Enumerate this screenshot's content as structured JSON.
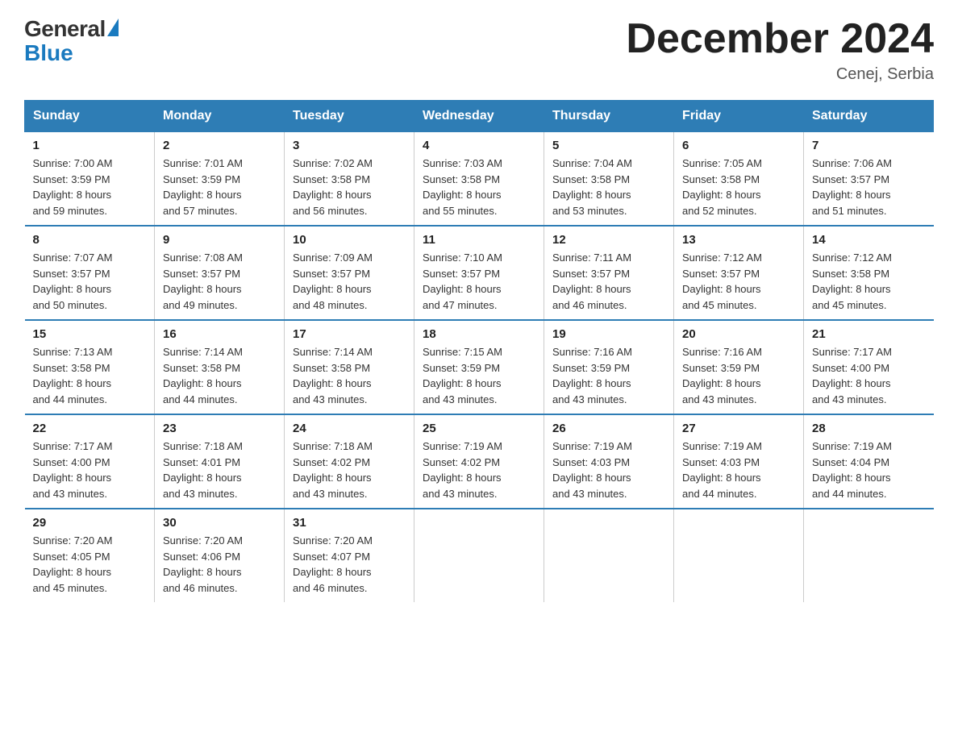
{
  "logo": {
    "general": "General",
    "blue": "Blue"
  },
  "header": {
    "title": "December 2024",
    "location": "Cenej, Serbia"
  },
  "days_of_week": [
    "Sunday",
    "Monday",
    "Tuesday",
    "Wednesday",
    "Thursday",
    "Friday",
    "Saturday"
  ],
  "weeks": [
    [
      {
        "num": "1",
        "sunrise": "7:00 AM",
        "sunset": "3:59 PM",
        "daylight": "8 hours and 59 minutes."
      },
      {
        "num": "2",
        "sunrise": "7:01 AM",
        "sunset": "3:59 PM",
        "daylight": "8 hours and 57 minutes."
      },
      {
        "num": "3",
        "sunrise": "7:02 AM",
        "sunset": "3:58 PM",
        "daylight": "8 hours and 56 minutes."
      },
      {
        "num": "4",
        "sunrise": "7:03 AM",
        "sunset": "3:58 PM",
        "daylight": "8 hours and 55 minutes."
      },
      {
        "num": "5",
        "sunrise": "7:04 AM",
        "sunset": "3:58 PM",
        "daylight": "8 hours and 53 minutes."
      },
      {
        "num": "6",
        "sunrise": "7:05 AM",
        "sunset": "3:58 PM",
        "daylight": "8 hours and 52 minutes."
      },
      {
        "num": "7",
        "sunrise": "7:06 AM",
        "sunset": "3:57 PM",
        "daylight": "8 hours and 51 minutes."
      }
    ],
    [
      {
        "num": "8",
        "sunrise": "7:07 AM",
        "sunset": "3:57 PM",
        "daylight": "8 hours and 50 minutes."
      },
      {
        "num": "9",
        "sunrise": "7:08 AM",
        "sunset": "3:57 PM",
        "daylight": "8 hours and 49 minutes."
      },
      {
        "num": "10",
        "sunrise": "7:09 AM",
        "sunset": "3:57 PM",
        "daylight": "8 hours and 48 minutes."
      },
      {
        "num": "11",
        "sunrise": "7:10 AM",
        "sunset": "3:57 PM",
        "daylight": "8 hours and 47 minutes."
      },
      {
        "num": "12",
        "sunrise": "7:11 AM",
        "sunset": "3:57 PM",
        "daylight": "8 hours and 46 minutes."
      },
      {
        "num": "13",
        "sunrise": "7:12 AM",
        "sunset": "3:57 PM",
        "daylight": "8 hours and 45 minutes."
      },
      {
        "num": "14",
        "sunrise": "7:12 AM",
        "sunset": "3:58 PM",
        "daylight": "8 hours and 45 minutes."
      }
    ],
    [
      {
        "num": "15",
        "sunrise": "7:13 AM",
        "sunset": "3:58 PM",
        "daylight": "8 hours and 44 minutes."
      },
      {
        "num": "16",
        "sunrise": "7:14 AM",
        "sunset": "3:58 PM",
        "daylight": "8 hours and 44 minutes."
      },
      {
        "num": "17",
        "sunrise": "7:14 AM",
        "sunset": "3:58 PM",
        "daylight": "8 hours and 43 minutes."
      },
      {
        "num": "18",
        "sunrise": "7:15 AM",
        "sunset": "3:59 PM",
        "daylight": "8 hours and 43 minutes."
      },
      {
        "num": "19",
        "sunrise": "7:16 AM",
        "sunset": "3:59 PM",
        "daylight": "8 hours and 43 minutes."
      },
      {
        "num": "20",
        "sunrise": "7:16 AM",
        "sunset": "3:59 PM",
        "daylight": "8 hours and 43 minutes."
      },
      {
        "num": "21",
        "sunrise": "7:17 AM",
        "sunset": "4:00 PM",
        "daylight": "8 hours and 43 minutes."
      }
    ],
    [
      {
        "num": "22",
        "sunrise": "7:17 AM",
        "sunset": "4:00 PM",
        "daylight": "8 hours and 43 minutes."
      },
      {
        "num": "23",
        "sunrise": "7:18 AM",
        "sunset": "4:01 PM",
        "daylight": "8 hours and 43 minutes."
      },
      {
        "num": "24",
        "sunrise": "7:18 AM",
        "sunset": "4:02 PM",
        "daylight": "8 hours and 43 minutes."
      },
      {
        "num": "25",
        "sunrise": "7:19 AM",
        "sunset": "4:02 PM",
        "daylight": "8 hours and 43 minutes."
      },
      {
        "num": "26",
        "sunrise": "7:19 AM",
        "sunset": "4:03 PM",
        "daylight": "8 hours and 43 minutes."
      },
      {
        "num": "27",
        "sunrise": "7:19 AM",
        "sunset": "4:03 PM",
        "daylight": "8 hours and 44 minutes."
      },
      {
        "num": "28",
        "sunrise": "7:19 AM",
        "sunset": "4:04 PM",
        "daylight": "8 hours and 44 minutes."
      }
    ],
    [
      {
        "num": "29",
        "sunrise": "7:20 AM",
        "sunset": "4:05 PM",
        "daylight": "8 hours and 45 minutes."
      },
      {
        "num": "30",
        "sunrise": "7:20 AM",
        "sunset": "4:06 PM",
        "daylight": "8 hours and 46 minutes."
      },
      {
        "num": "31",
        "sunrise": "7:20 AM",
        "sunset": "4:07 PM",
        "daylight": "8 hours and 46 minutes."
      },
      null,
      null,
      null,
      null
    ]
  ],
  "labels": {
    "sunrise": "Sunrise:",
    "sunset": "Sunset:",
    "daylight": "Daylight:"
  }
}
